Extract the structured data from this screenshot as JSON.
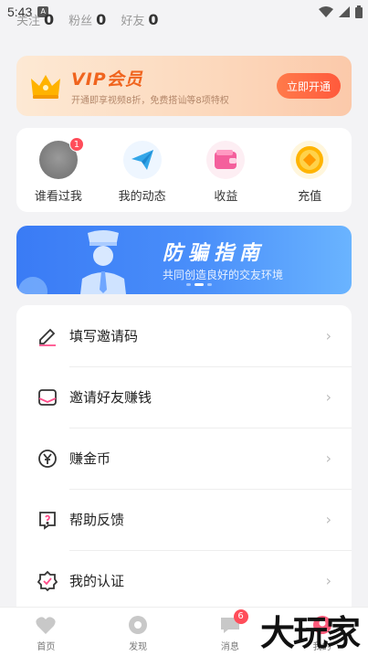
{
  "status_bar": {
    "time": "5:43",
    "a_label": "A"
  },
  "stats": [
    {
      "label": "关注",
      "value": "0"
    },
    {
      "label": "粉丝",
      "value": "0"
    },
    {
      "label": "好友",
      "value": "0"
    }
  ],
  "vip": {
    "title": "VIP会员",
    "subtitle": "开通即享视频8折，免费搭讪等8项特权",
    "button": "立即开通"
  },
  "quick_actions": [
    {
      "label": "谁看过我",
      "icon": "avatar",
      "badge": "1"
    },
    {
      "label": "我的动态",
      "icon": "paper-plane-icon"
    },
    {
      "label": "收益",
      "icon": "wallet-icon"
    },
    {
      "label": "充值",
      "icon": "coin-icon"
    }
  ],
  "banner": {
    "title": "防骗指南",
    "subtitle": "共同创造良好的交友环境"
  },
  "menu": [
    {
      "label": "填写邀请码",
      "icon": "pen-icon"
    },
    {
      "label": "邀请好友赚钱",
      "icon": "envelope-icon"
    },
    {
      "label": "赚金币",
      "icon": "yen-coin-icon"
    },
    {
      "label": "帮助反馈",
      "icon": "help-icon"
    },
    {
      "label": "我的认证",
      "icon": "verified-badge-icon"
    }
  ],
  "bottom_nav": [
    {
      "label": "首页",
      "icon": "heart-icon"
    },
    {
      "label": "发现",
      "icon": "discover-icon"
    },
    {
      "label": "消息",
      "icon": "message-icon",
      "badge": "6"
    },
    {
      "label": "我的",
      "icon": "profile-icon"
    }
  ],
  "watermark": "大玩家",
  "colors": {
    "accent": "#f0641e",
    "banner_blue": "#3a7bf5",
    "badge_red": "#ff4d5a"
  }
}
